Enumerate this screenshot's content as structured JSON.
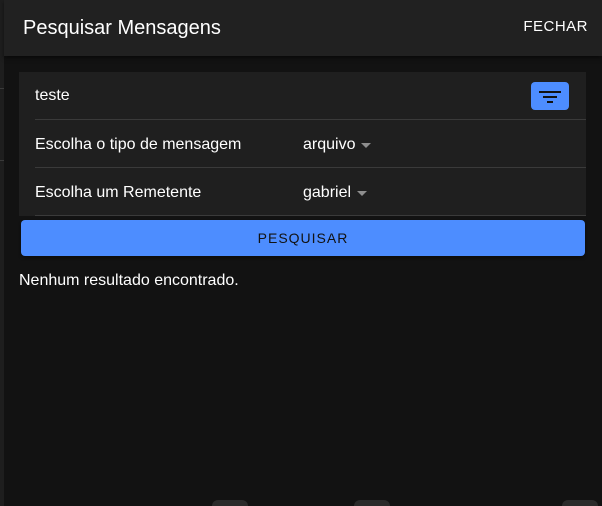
{
  "header": {
    "title": "Pesquisar Mensagens",
    "close_label": "FECHAR"
  },
  "search": {
    "query": "teste",
    "filter_icon": "filter-list-icon"
  },
  "filters": {
    "message_type": {
      "label": "Escolha o tipo de mensagem",
      "selected": "arquivo"
    },
    "sender": {
      "label": "Escolha um Remetente",
      "selected": "gabriel"
    }
  },
  "actions": {
    "search_label": "PESQUISAR"
  },
  "results": {
    "empty_text": "Nenhum resultado encontrado."
  },
  "colors": {
    "accent": "#4d8dff",
    "header_bg": "#212121",
    "card_bg": "#1f1f1f",
    "page_bg": "#121212",
    "text": "#ffffff"
  }
}
